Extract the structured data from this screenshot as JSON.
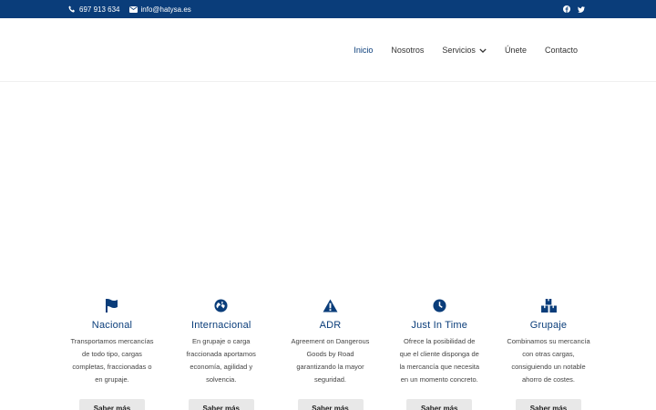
{
  "topbar": {
    "phone": "697 913 634",
    "email": "info@hatysa.es",
    "social": [
      "facebook-icon",
      "twitter-icon"
    ]
  },
  "nav": {
    "items": [
      {
        "label": "Inicio",
        "active": true
      },
      {
        "label": "Nosotros"
      },
      {
        "label": "Servicios",
        "dropdown": true
      },
      {
        "label": "Únete"
      },
      {
        "label": "Contacto"
      }
    ]
  },
  "features": [
    {
      "icon": "flag-icon",
      "title": "Nacional",
      "text": "Transportamos mercancías de todo tipo, cargas completas, fraccionadas o en grupaje.",
      "button": "Saber más"
    },
    {
      "icon": "globe-icon",
      "title": "Internacional",
      "text": "En grupaje o carga fraccionada aportamos economía, agilidad y solvencia.",
      "button": "Saber más"
    },
    {
      "icon": "warning-icon",
      "title": "ADR",
      "text": "Agreement on Dangerous Goods by Road garantizando la mayor seguridad.",
      "button": "Saber más"
    },
    {
      "icon": "clock-icon",
      "title": "Just In Time",
      "text": "Ofrece la posibilidad de que el cliente disponga de la mercancía que necesita en un momento concreto.",
      "button": "Saber más"
    },
    {
      "icon": "boxes-icon",
      "title": "Grupaje",
      "text": "Combinamos su mercancía con otras cargas, consiguiendo un notable ahorro de costes.",
      "button": "Saber más"
    }
  ],
  "colors": {
    "brand": "#0a3d7a",
    "button_bg": "#e8e8e8"
  }
}
